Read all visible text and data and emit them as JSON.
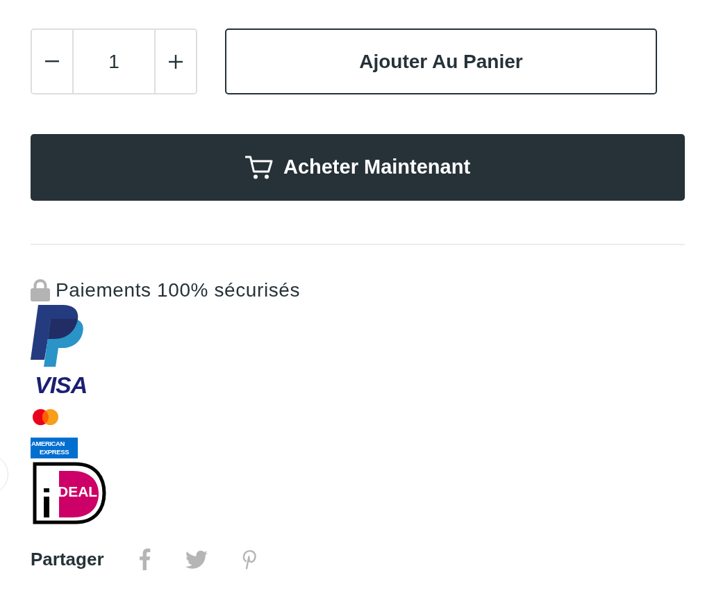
{
  "quantity": {
    "value": "1"
  },
  "add_to_cart_button": "Ajouter Au Panier",
  "buy_now_button": "Acheter Maintenant",
  "secure_payment": {
    "text": "Paiements 100% sécurisés"
  },
  "payment_logos": [
    {
      "kind": "paypal"
    },
    {
      "kind": "visa",
      "text": "VISA"
    },
    {
      "kind": "mastercard"
    },
    {
      "kind": "amex",
      "lines": [
        "AMERICAN",
        "EXPRESS"
      ]
    },
    {
      "kind": "ideal",
      "letter": "i",
      "text": "DEAL"
    }
  ],
  "share": {
    "label": "Partager",
    "networks": [
      {
        "kind": "facebook"
      },
      {
        "kind": "twitter"
      },
      {
        "kind": "pinterest"
      }
    ]
  }
}
